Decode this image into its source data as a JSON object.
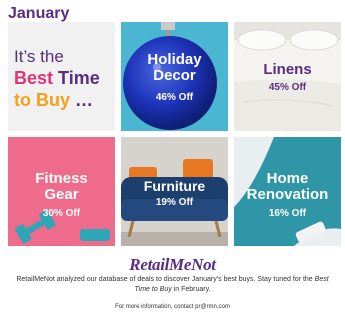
{
  "header": {
    "month": "January"
  },
  "intro": {
    "line1": "It’s the",
    "best": "Best",
    "time": "Time",
    "to_buy": "to Buy",
    "dots": "…"
  },
  "tiles": [
    {
      "name": "Holiday Decor",
      "line1": "Holiday",
      "line2": "Decor",
      "percent": "46% Off"
    },
    {
      "name": "Linens",
      "line1": "Linens",
      "line2": "",
      "percent": "45% Off"
    },
    {
      "name": "Fitness Gear",
      "line1": "Fitness",
      "line2": "Gear",
      "percent": "30% Off"
    },
    {
      "name": "Furniture",
      "line1": "Furniture",
      "line2": "",
      "percent": "19% Off"
    },
    {
      "name": "Home Renovation",
      "line1": "Home",
      "line2": "Renovation",
      "percent": "16% Off"
    }
  ],
  "brand": {
    "logo_text": "RetailMeNot"
  },
  "footer": {
    "blurb_part1": "RetailMeNot analyzed our database of deals to discover January’s best buys. Stay tuned for the",
    "blurb_emphasis": "Best Time to Buy",
    "blurb_part2": "in February.",
    "contact": "For more information, contact pr@rmn.com"
  },
  "colors": {
    "purple": "#5a2d82",
    "pink": "#e0337a",
    "orange": "#f2a21b",
    "teal": "#2e96a6",
    "fitness_pink": "#ee6b8b"
  }
}
